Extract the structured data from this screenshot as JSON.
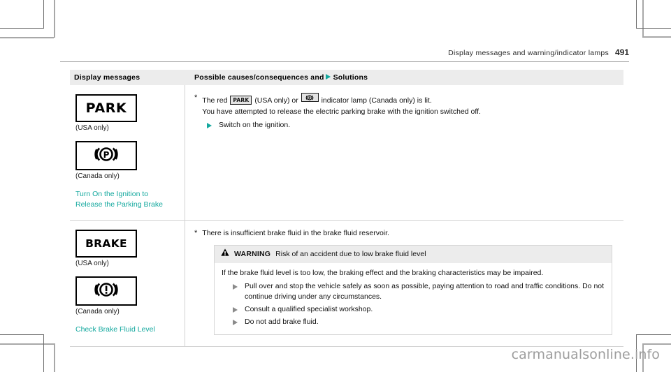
{
  "page": {
    "running_head": "Display messages and warning/indicator lamps",
    "page_number": "491",
    "watermark": "carmanualsonline.info"
  },
  "table": {
    "headers": {
      "col1": "Display messages",
      "col2_before": "Possible causes/consequences and",
      "col2_after": "Solutions"
    },
    "rows": [
      {
        "symbols": [
          {
            "type": "word-box",
            "text": "PARK",
            "caption": "(USA only)"
          },
          {
            "type": "icon-box",
            "icon": "parking-brake-p-icon",
            "caption": "(Canada only)"
          }
        ],
        "message_label": "Turn On the Ignition to\nRelease the Parking Brake",
        "message_label_line1": "Turn On the Ignition to",
        "message_label_line2": "Release the Parking Brake",
        "cause_prefix": "The red",
        "inline_badge_1": "PARK",
        "cause_mid": "(USA only) or",
        "inline_badge_2": "parking-brake-p-icon",
        "cause_suffix": "indicator lamp (Canada only) is lit.",
        "consequence": "You have attempted to release the electric parking brake with the ignition switched off.",
        "solutions": [
          "Switch on the ignition."
        ]
      },
      {
        "symbols": [
          {
            "type": "word-box",
            "text": "BRAKE",
            "caption": "(USA only)"
          },
          {
            "type": "icon-box",
            "icon": "brake-warning-exclamation-icon",
            "caption": "(Canada only)"
          }
        ],
        "message_label_line1": "Check Brake Fluid Level",
        "message_label_line2": "",
        "cause": "There is insufficient brake fluid in the brake fluid reservoir.",
        "warning": {
          "title": "WARNING",
          "subtitle": "Risk of an accident due to low brake fluid level",
          "intro": "If the brake fluid level is too low, the braking effect and the braking characteristics may be impaired.",
          "items": [
            "Pull over and stop the vehicle safely as soon as possible, paying attention to road and traffic conditions. Do not continue driving under any circumstances.",
            "Consult a qualified specialist workshop.",
            "Do not add brake fluid."
          ]
        }
      }
    ]
  },
  "colors": {
    "accent_teal": "#13a89e",
    "header_gray": "#ececec",
    "rule_gray": "#d2d2d2"
  }
}
